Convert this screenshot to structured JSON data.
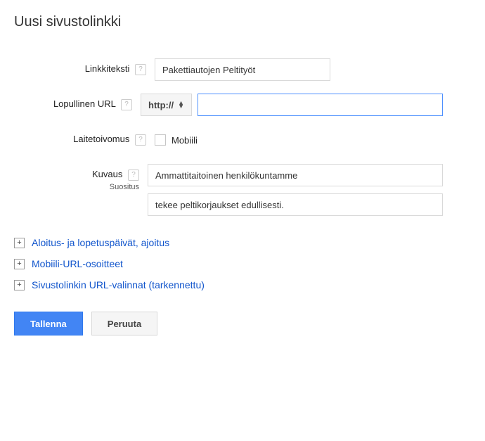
{
  "page_title": "Uusi sivustolinkki",
  "fields": {
    "link_text": {
      "label": "Linkkiteksti",
      "value": "Pakettiautojen Peltityöt"
    },
    "final_url": {
      "label": "Lopullinen URL",
      "protocol": "http://",
      "value": ""
    },
    "device_pref": {
      "label": "Laitetoivomus",
      "checkbox_label": "Mobiili"
    },
    "description": {
      "label": "Kuvaus",
      "sublabel": "Suositus",
      "line1": "Ammattitaitoinen henkilökuntamme",
      "line2": "tekee peltikorjaukset edullisesti."
    }
  },
  "expanders": [
    "Aloitus- ja lopetuspäivät, ajoitus",
    "Mobiili-URL-osoitteet",
    "Sivustolinkin URL-valinnat (tarkennettu)"
  ],
  "buttons": {
    "save": "Tallenna",
    "cancel": "Peruuta"
  }
}
